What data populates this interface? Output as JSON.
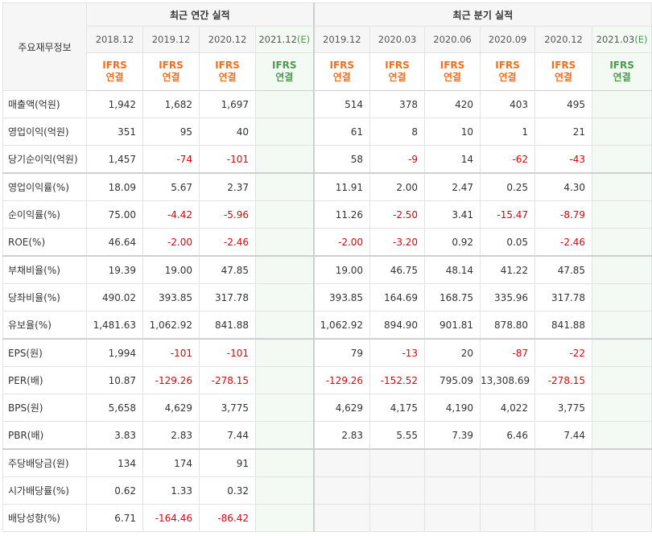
{
  "header": {
    "corner_label": "주요재무정보",
    "annual_group": "최근 연간 실적",
    "quarter_group": "최근 분기 실적"
  },
  "periods": {
    "annual": [
      "2018.12",
      "2019.12",
      "2020.12",
      "2021.12"
    ],
    "quarter": [
      "2019.12",
      "2020.03",
      "2020.06",
      "2020.09",
      "2020.12",
      "2021.03"
    ],
    "estimate_mark": "(E)"
  },
  "basis": {
    "line1": "IFRS",
    "line2": "연결"
  },
  "rows": [
    {
      "label": "매출액(억원)",
      "annual": [
        "1,942",
        "1,682",
        "1,697",
        ""
      ],
      "quarter": [
        "514",
        "378",
        "420",
        "403",
        "495",
        ""
      ]
    },
    {
      "label": "영업이익(억원)",
      "annual": [
        "351",
        "95",
        "40",
        ""
      ],
      "quarter": [
        "61",
        "8",
        "10",
        "1",
        "21",
        ""
      ]
    },
    {
      "label": "당기순이익(억원)",
      "annual": [
        "1,457",
        "-74",
        "-101",
        ""
      ],
      "quarter": [
        "58",
        "-9",
        "14",
        "-62",
        "-43",
        ""
      ]
    },
    {
      "label": "영업이익률(%)",
      "annual": [
        "18.09",
        "5.67",
        "2.37",
        ""
      ],
      "quarter": [
        "11.91",
        "2.00",
        "2.47",
        "0.25",
        "4.30",
        ""
      ]
    },
    {
      "label": "순이익률(%)",
      "annual": [
        "75.00",
        "-4.42",
        "-5.96",
        ""
      ],
      "quarter": [
        "11.26",
        "-2.50",
        "3.41",
        "-15.47",
        "-8.79",
        ""
      ]
    },
    {
      "label": "ROE(%)",
      "annual": [
        "46.64",
        "-2.00",
        "-2.46",
        ""
      ],
      "quarter": [
        "-2.00",
        "-3.20",
        "0.92",
        "0.05",
        "-2.46",
        ""
      ]
    },
    {
      "label": "부채비율(%)",
      "annual": [
        "19.39",
        "19.00",
        "47.85",
        ""
      ],
      "quarter": [
        "19.00",
        "46.75",
        "48.14",
        "41.22",
        "47.85",
        ""
      ]
    },
    {
      "label": "당좌비율(%)",
      "annual": [
        "490.02",
        "393.85",
        "317.78",
        ""
      ],
      "quarter": [
        "393.85",
        "164.69",
        "168.75",
        "335.96",
        "317.78",
        ""
      ]
    },
    {
      "label": "유보율(%)",
      "annual": [
        "1,481.63",
        "1,062.92",
        "841.88",
        ""
      ],
      "quarter": [
        "1,062.92",
        "894.90",
        "901.81",
        "878.80",
        "841.88",
        ""
      ]
    },
    {
      "label": "EPS(원)",
      "annual": [
        "1,994",
        "-101",
        "-101",
        ""
      ],
      "quarter": [
        "79",
        "-13",
        "20",
        "-87",
        "-22",
        ""
      ]
    },
    {
      "label": "PER(배)",
      "annual": [
        "10.87",
        "-129.26",
        "-278.15",
        ""
      ],
      "quarter": [
        "-129.26",
        "-152.52",
        "795.09",
        "13,308.69",
        "-278.15",
        ""
      ]
    },
    {
      "label": "BPS(원)",
      "annual": [
        "5,658",
        "4,629",
        "3,775",
        ""
      ],
      "quarter": [
        "4,629",
        "4,175",
        "4,190",
        "4,022",
        "3,775",
        ""
      ]
    },
    {
      "label": "PBR(배)",
      "annual": [
        "3.83",
        "2.83",
        "7.44",
        ""
      ],
      "quarter": [
        "2.83",
        "5.55",
        "7.39",
        "6.46",
        "7.44",
        ""
      ]
    },
    {
      "label": "주당배당금(원)",
      "annual": [
        "134",
        "174",
        "91",
        ""
      ],
      "quarter": [
        "",
        "",
        "",
        "",
        "",
        ""
      ]
    },
    {
      "label": "시가배당률(%)",
      "annual": [
        "0.62",
        "1.33",
        "0.32",
        ""
      ],
      "quarter": [
        "",
        "",
        "",
        "",
        "",
        ""
      ]
    },
    {
      "label": "배당성향(%)",
      "annual": [
        "6.71",
        "-164.46",
        "-86.42",
        ""
      ],
      "quarter": [
        "",
        "",
        "",
        "",
        "",
        ""
      ]
    }
  ],
  "colors": {
    "negative": "#e0000c",
    "ifrs_actual": "#f36f1f",
    "ifrs_estimate": "#4d9a4d",
    "estimate_bg": "#f3faf3"
  }
}
